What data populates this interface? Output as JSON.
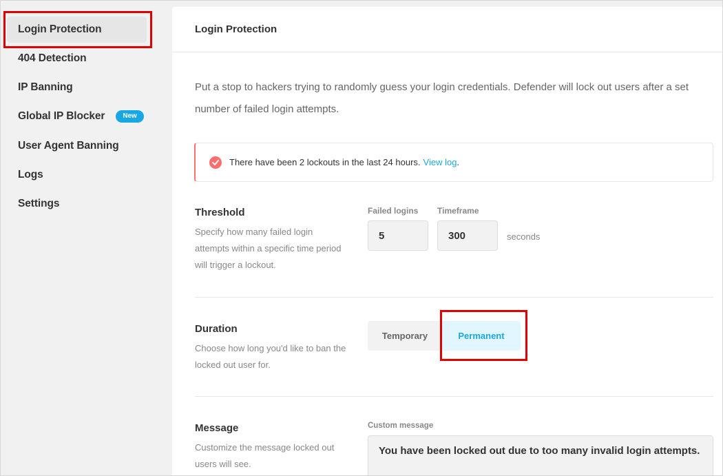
{
  "sidebar": {
    "items": [
      {
        "label": "Login Protection",
        "active": true
      },
      {
        "label": "404 Detection"
      },
      {
        "label": "IP Banning"
      },
      {
        "label": "Global IP Blocker",
        "badge": "New"
      },
      {
        "label": "User Agent Banning"
      },
      {
        "label": "Logs"
      },
      {
        "label": "Settings"
      }
    ]
  },
  "panel": {
    "title": "Login Protection",
    "intro": "Put a stop to hackers trying to randomly guess your login credentials. Defender will lock out users after a set number of failed login attempts.",
    "notice": {
      "text": "There have been 2 lockouts in the last 24 hours.",
      "link": "View log",
      "trailing": "."
    },
    "threshold": {
      "title": "Threshold",
      "description": "Specify how many failed login attempts within a specific time period will trigger a lockout.",
      "failed_logins_label": "Failed logins",
      "failed_logins_value": "5",
      "timeframe_label": "Timeframe",
      "timeframe_value": "300",
      "timeframe_unit": "seconds"
    },
    "duration": {
      "title": "Duration",
      "description": "Choose how long you'd like to ban the locked out user for.",
      "options": [
        "Temporary",
        "Permanent"
      ],
      "selected": "Permanent"
    },
    "message": {
      "title": "Message",
      "description": "Customize the message locked out users will see.",
      "custom_label": "Custom message",
      "custom_value": "You have been locked out due to too many invalid login attempts."
    }
  },
  "colors": {
    "accent": "#17a8e3",
    "notice": "#ff6d6d",
    "highlight": "#e10000"
  }
}
